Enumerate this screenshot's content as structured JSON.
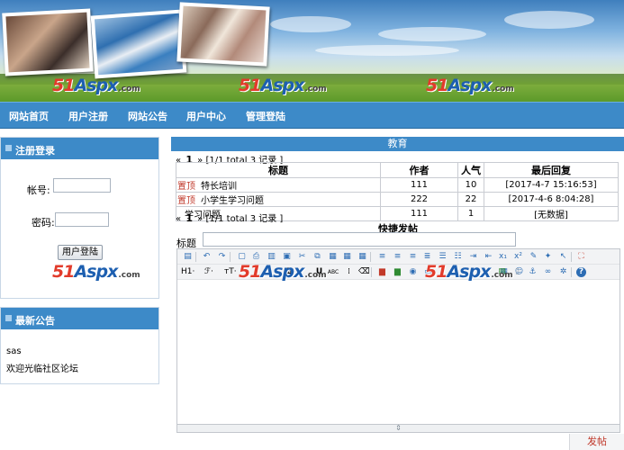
{
  "banner": {
    "watermark": {
      "num": "51",
      "brand": "Aspx",
      "domain": ".com"
    }
  },
  "nav": {
    "items": [
      "网站首页",
      "用户注册",
      "网站公告",
      "用户中心",
      "管理登陆"
    ]
  },
  "login": {
    "title": "注册登录",
    "account_label": "帐号:",
    "password_label": "密码:",
    "account_value": "",
    "password_value": "",
    "button": "用户登陆"
  },
  "notice": {
    "title": "最新公告",
    "lines": [
      "sas",
      "欢迎光临社区论坛"
    ]
  },
  "forum": {
    "title": "教育",
    "pager": {
      "prev": "«",
      "current": "1",
      "next": "»",
      "info": "[1/1 total 3 记录 ]"
    },
    "columns": [
      "标题",
      "作者",
      "人气",
      "最后回复"
    ],
    "rows": [
      {
        "tag": "置顶",
        "title": "特长培训",
        "author": "111",
        "views": "10",
        "last_reply": "[2017-4-7 15:16:53]"
      },
      {
        "tag": "置顶",
        "title": "小学生学习问题",
        "author": "222",
        "views": "22",
        "last_reply": "[2017-4-6 8:04:28]"
      },
      {
        "tag": "",
        "title": "学习问题",
        "author": "111",
        "views": "1",
        "last_reply": "[无数据]"
      }
    ],
    "quick_post": "快捷发帖",
    "title_label": "标题",
    "title_value": "",
    "post_button": "发帖"
  },
  "editor": {
    "heading_tool": "H1·",
    "font_tool": "ℱ·",
    "size_tool": "тT·",
    "bold": "B",
    "underline": "U",
    "abc": "ABC"
  }
}
